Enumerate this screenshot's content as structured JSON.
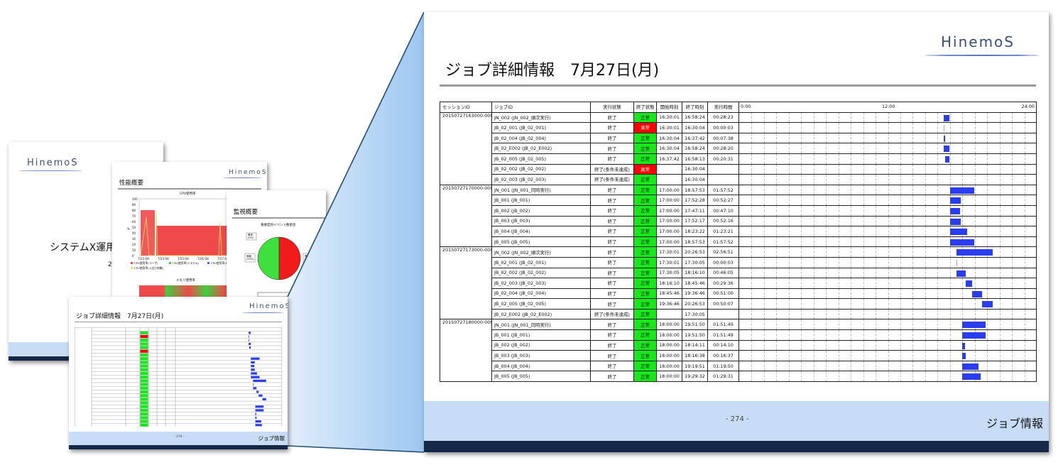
{
  "logo_text": "HinemoS",
  "main_page": {
    "title": "ジョブ詳細情報　7月27日(月)",
    "footer_page": "- 274 -",
    "footer_label": "ジョブ情報",
    "columns": [
      "セッションID",
      "ジョブID",
      "実行状態",
      "終了状態",
      "開始時刻",
      "終了時刻",
      "実行時間"
    ],
    "timeline_labels": [
      "0:00",
      "12:00",
      "24:00"
    ],
    "status_colors": {
      "ok": "#19e61d",
      "error": "#ff0000",
      "bar": "#2a3ef0"
    },
    "rows": [
      {
        "session": "20150727163000-000",
        "job": "JN_002 (JN_002_順次実行)",
        "indent": false,
        "run": "終了",
        "end": "正常",
        "end_type": "ok",
        "start": "16:30:01",
        "finish": "16:58:24",
        "dur": "00:28:23"
      },
      {
        "session": "",
        "job": "JB_02_001 (JB_02_001)",
        "indent": true,
        "run": "終了",
        "end": "異常",
        "end_type": "err",
        "start": "16:30:01",
        "finish": "16:30:04",
        "dur": "00:00:03"
      },
      {
        "session": "",
        "job": "JB_02_004 (JB_02_004)",
        "indent": true,
        "run": "終了",
        "end": "正常",
        "end_type": "ok",
        "start": "16:30:04",
        "finish": "16:37:42",
        "dur": "00:07:38"
      },
      {
        "session": "",
        "job": "JB_02_E002 (JB_02_E002)",
        "indent": true,
        "run": "終了",
        "end": "正常",
        "end_type": "ok",
        "start": "16:30:04",
        "finish": "16:58:24",
        "dur": "00:28:20"
      },
      {
        "session": "",
        "job": "JB_02_005 (JB_02_005)",
        "indent": true,
        "run": "終了",
        "end": "正常",
        "end_type": "ok",
        "start": "16:37:42",
        "finish": "16:58:13",
        "dur": "00:20:31"
      },
      {
        "session": "",
        "job": "JB_02_002 (JB_02_002)",
        "indent": true,
        "run": "終了(条件未達成)",
        "end": "異常",
        "end_type": "err",
        "start": "",
        "finish": "16:30:04",
        "dur": ""
      },
      {
        "session": "",
        "job": "JB_02_003 (JB_02_003)",
        "indent": true,
        "run": "終了(条件未達成)",
        "end": "正常",
        "end_type": "ok",
        "start": "",
        "finish": "16:30:04",
        "dur": ""
      },
      {
        "session": "20150727170000-000",
        "job": "JN_001 (JN_001_同時実行)",
        "indent": false,
        "run": "終了",
        "end": "正常",
        "end_type": "ok",
        "start": "17:00:00",
        "finish": "18:57:53",
        "dur": "01:57:52"
      },
      {
        "session": "",
        "job": "JB_001 (JB_001)",
        "indent": true,
        "run": "終了",
        "end": "正常",
        "end_type": "ok",
        "start": "17:00:00",
        "finish": "17:52:28",
        "dur": "00:52:27"
      },
      {
        "session": "",
        "job": "JB_002 (JB_002)",
        "indent": true,
        "run": "終了",
        "end": "正常",
        "end_type": "ok",
        "start": "17:00:00",
        "finish": "17:47:11",
        "dur": "00:47:10"
      },
      {
        "session": "",
        "job": "JB_003 (JB_003)",
        "indent": true,
        "run": "終了",
        "end": "正常",
        "end_type": "ok",
        "start": "17:00:00",
        "finish": "17:52:17",
        "dur": "00:52:16"
      },
      {
        "session": "",
        "job": "JB_004 (JB_004)",
        "indent": true,
        "run": "終了",
        "end": "正常",
        "end_type": "ok",
        "start": "17:00:00",
        "finish": "18:23:22",
        "dur": "01:23:21"
      },
      {
        "session": "",
        "job": "JB_005 (JB_005)",
        "indent": true,
        "run": "終了",
        "end": "正常",
        "end_type": "ok",
        "start": "17:00:00",
        "finish": "18:57:53",
        "dur": "01:57:52"
      },
      {
        "session": "20150727173000-000",
        "job": "JN_002 (JN_002_順次実行)",
        "indent": false,
        "run": "終了",
        "end": "正常",
        "end_type": "ok",
        "start": "17:30:01",
        "finish": "20:26:53",
        "dur": "02:56:51"
      },
      {
        "session": "",
        "job": "JB_02_001 (JB_02_001)",
        "indent": true,
        "run": "終了",
        "end": "正常",
        "end_type": "ok",
        "start": "17:30:01",
        "finish": "17:30:05",
        "dur": "00:00:03"
      },
      {
        "session": "",
        "job": "JB_02_002 (JB_02_002)",
        "indent": true,
        "run": "終了",
        "end": "正常",
        "end_type": "ok",
        "start": "17:30:05",
        "finish": "18:16:10",
        "dur": "00:46:05"
      },
      {
        "session": "",
        "job": "JB_02_003 (JB_02_003)",
        "indent": true,
        "run": "終了",
        "end": "正常",
        "end_type": "ok",
        "start": "18:16:10",
        "finish": "18:45:46",
        "dur": "00:29:36"
      },
      {
        "session": "",
        "job": "JB_02_004 (JB_02_004)",
        "indent": true,
        "run": "終了",
        "end": "正常",
        "end_type": "ok",
        "start": "18:45:46",
        "finish": "19:36:46",
        "dur": "00:51:00"
      },
      {
        "session": "",
        "job": "JB_02_005 (JB_02_005)",
        "indent": true,
        "run": "終了",
        "end": "正常",
        "end_type": "ok",
        "start": "19:36:46",
        "finish": "20:26:53",
        "dur": "00:50:07"
      },
      {
        "session": "",
        "job": "JB_02_E002 (JB_02_E002)",
        "indent": true,
        "run": "終了(条件未達成)",
        "end": "正常",
        "end_type": "ok",
        "start": "",
        "finish": "17:30:05",
        "dur": ""
      },
      {
        "session": "20150727180000-000",
        "job": "JN_001 (JN_001_同時実行)",
        "indent": false,
        "run": "終了",
        "end": "正常",
        "end_type": "ok",
        "start": "18:00:00",
        "finish": "19:51:50",
        "dur": "01:51:49"
      },
      {
        "session": "",
        "job": "JB_001 (JB_001)",
        "indent": true,
        "run": "終了",
        "end": "正常",
        "end_type": "ok",
        "start": "18:00:00",
        "finish": "19:51:50",
        "dur": "01:51:49"
      },
      {
        "session": "",
        "job": "JB_002 (JB_002)",
        "indent": true,
        "run": "終了",
        "end": "正常",
        "end_type": "ok",
        "start": "18:00:00",
        "finish": "18:14:11",
        "dur": "00:14:10"
      },
      {
        "session": "",
        "job": "JB_003 (JB_003)",
        "indent": true,
        "run": "終了",
        "end": "正常",
        "end_type": "ok",
        "start": "18:00:00",
        "finish": "18:16:38",
        "dur": "00:16:37"
      },
      {
        "session": "",
        "job": "JB_004 (JB_004)",
        "indent": true,
        "run": "終了",
        "end": "正常",
        "end_type": "ok",
        "start": "18:00:00",
        "finish": "19:19:51",
        "dur": "01:19:50"
      },
      {
        "session": "",
        "job": "JB_005 (JB_005)",
        "indent": true,
        "run": "終了",
        "end": "正常",
        "end_type": "ok",
        "start": "18:00:00",
        "finish": "19:29:32",
        "dur": "01:29:31"
      }
    ]
  },
  "page1": {
    "title": "システムX運用",
    "sub": "20"
  },
  "page2": {
    "title": "性能概要",
    "chart_title": "CPU使用率",
    "yticks": [
      "100",
      "90",
      "80",
      "70",
      "60",
      "50",
      "40",
      "30",
      "20",
      "10",
      "0"
    ],
    "yunit": "%",
    "xticks": [
      "7/23 0H",
      "7/24 0H",
      "7/25 0H",
      "7/26 0H",
      "7/27 0H",
      "7/28 0H"
    ],
    "legend": [
      "CPU使用率(ユーザ)",
      "CPU使用率(システム)",
      "CPU使用率(Niceプロセ",
      "CPU使用率(入出力待機)"
    ],
    "chart2_title": "メモリ使用率"
  },
  "page3": {
    "title": "監視概要",
    "chart_title": "重要度別イベント数割合",
    "slice_warning": "警告\n(50%)",
    "slice_info": "情報\n(50%)",
    "slice_top": "異常\n(0%)"
  },
  "page4": {
    "title": "ジョブ詳細情報　7月27日(月)",
    "footer_page": "- 274 -",
    "footer_label": "ジョブ情報"
  }
}
